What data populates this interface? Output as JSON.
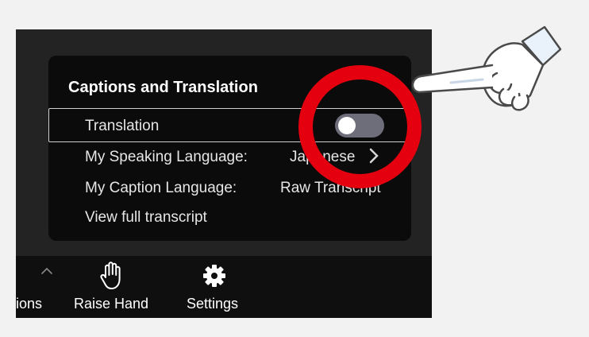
{
  "panel": {
    "title": "Captions and Translation",
    "rows": {
      "translation": {
        "label": "Translation",
        "toggle_on": false
      },
      "speaking_language": {
        "label": "My Speaking Language:",
        "value": "Japanese"
      },
      "caption_language": {
        "label": "My Caption Language:",
        "value": "Raw Transcript"
      },
      "transcript": {
        "label": "View full transcript"
      }
    }
  },
  "toolbar": {
    "partial_label": "ions",
    "raise_hand": {
      "label": "Raise Hand",
      "icon": "raised-hand-icon"
    },
    "settings": {
      "label": "Settings",
      "icon": "gear-icon"
    },
    "more_icon": "chevron-up-icon"
  },
  "annotation": {
    "ring_color": "#e4000f",
    "pointer_icon": "pointing-hand-icon"
  },
  "colors": {
    "toggle_off": "#6e6e7a",
    "panel_bg": "#0b0b0b",
    "app_bg": "#232323",
    "toolbar_bg": "#0f0f0f"
  }
}
